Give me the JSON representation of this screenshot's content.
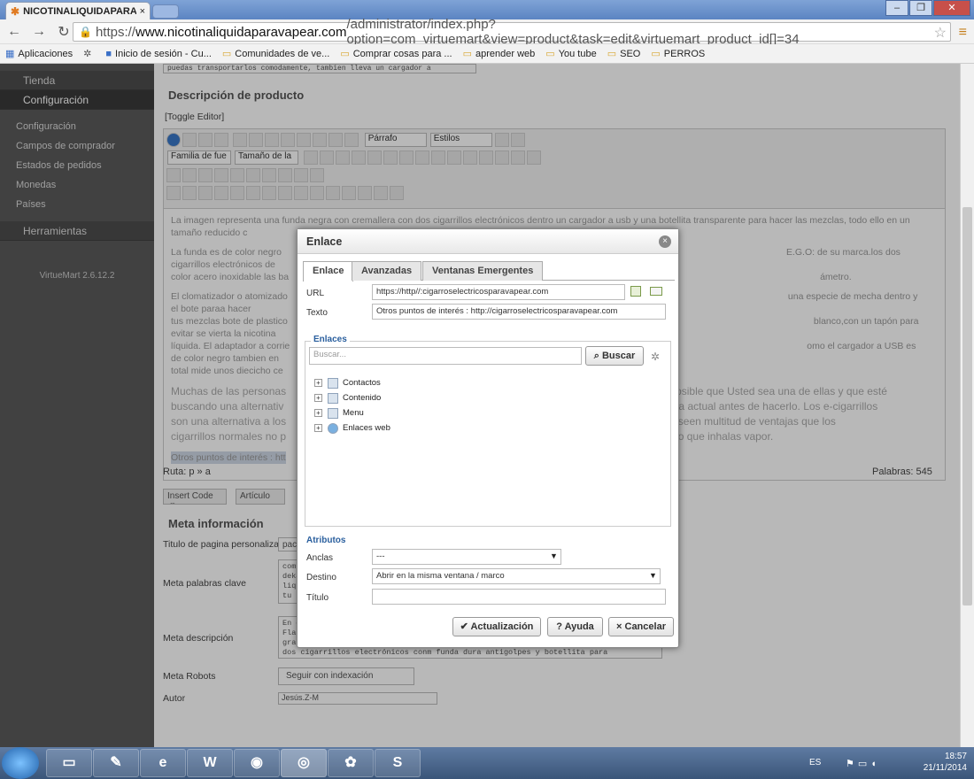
{
  "browser": {
    "tab_title": "NICOTINALIQUIDAPARAV",
    "url_prefix": "https://",
    "url_host": "www.nicotinaliquidaparavapear.com",
    "url_path": "/administrator/index.php?option=com_virtuemart&view=product&task=edit&virtuemart_product_id[]=34",
    "bookmarks": [
      "Aplicaciones",
      "Inicio de sesión - Cu...",
      "Comunidades de ve...",
      "Comprar cosas para ...",
      "aprender web",
      "You tube",
      "SEO",
      "PERROS"
    ]
  },
  "sidebar": {
    "sections": [
      "Tienda",
      "Configuración"
    ],
    "items": [
      "Configuración",
      "Campos de comprador",
      "Estados de pedidos",
      "Monedas",
      "Países"
    ],
    "tools": "Herramientas",
    "version": "VirtueMart 2.6.12.2"
  },
  "editor": {
    "header_text": "puedas transportarlos comodamente, tambien lleva un cargador a",
    "title": "Descripción de producto",
    "toggle": "[Toggle Editor]",
    "format_select": "Párrafo",
    "styles_select": "Estilos",
    "font_select": "Familia de fue",
    "size_select": "Tamaño de la",
    "para1": "La imagen representa una funda negra con cremallera con dos cigarrillos electrónicos dentro un cargador a usb y una botellita transparente para hacer las mezclas, todo ello en un tamaño reducido c",
    "para2a": "La  funda es de color negro",
    "para2b": "E.G.O: de su marca.los dos cigarrillos electrónicos de",
    "para2c": "color acero inoxidable las ba",
    "para2d": "ámetro.",
    "para3a": "El clomatizador  o atomizado",
    "para3b": "una especie de mecha dentro y el bote paraa hacer",
    "para3c": "tus mezclas bote de plastico",
    "para3d": "blanco,con un tapón para evitar se vierta la nicotina",
    "para3e": "líquida. El adaptador a corrie",
    "para3f": "omo el cargador a USB es de color negro tambien en",
    "para3g": "total mide unos diecicho ce",
    "big1a": "Muchas de las personas",
    "big1b": "osible que Usted sea una de ellas y que esté",
    "big2a": "buscando una alternativ",
    "big2b": "rca actual antes de hacerlo. Los e-cigarrillos",
    "big3a": "son una alternativa a los",
    "big3b": "oseen multitud de ventajas que los",
    "big4a": "cigarrillos normales no p",
    "big4b": "no que inhalas vapor.",
    "sel_line": "Otros puntos de interés : htt",
    "ruta": "Ruta:  p » a",
    "words": "Palabras: 545",
    "insert_code": "Insert Code <>",
    "articulo": "Artículo"
  },
  "meta": {
    "title": "Meta información",
    "page_title_label": "Titulo de pagina personalizado",
    "page_title_value": "pack",
    "keywords_label": "Meta palabras clave",
    "keywords_value": "com\ndeka\nliqu\ntu",
    "desc_label": "Meta descripción",
    "desc_value": "En c\nFlas\ngran\ndos cigarrillos electrónicos conm funda dura antigolpes y botellita para",
    "robots_label": "Meta Robots",
    "robots_value": "Seguir con indexación",
    "author_label": "Autor",
    "author_value": "Jesús.Z-M"
  },
  "dialog": {
    "title": "Enlace",
    "tabs": [
      "Enlace",
      "Avanzadas",
      "Ventanas Emergentes"
    ],
    "url_label": "URL",
    "url_value": "https://http//:cigarroselectricosparavapear.com",
    "text_label": "Texto",
    "text_value": "Otros puntos de interés : http://cigarroselectricosparavapear.com",
    "links_legend": "Enlaces",
    "search_placeholder": "Buscar...",
    "search_button": "Buscar",
    "tree": [
      "Contactos",
      "Contenido",
      "Menu",
      "Enlaces web"
    ],
    "attrs_legend": "Atributos",
    "anchors_label": "Anclas",
    "anchors_value": "---",
    "target_label": "Destino",
    "target_value": "Abrir en la misma ventana / marco",
    "title_label": "Título",
    "title_value": "",
    "btn_update": "Actualización",
    "btn_help": "Ayuda",
    "btn_cancel": "Cancelar"
  },
  "taskbar": {
    "lang": "ES",
    "time": "18:57",
    "date": "21/11/2014"
  }
}
